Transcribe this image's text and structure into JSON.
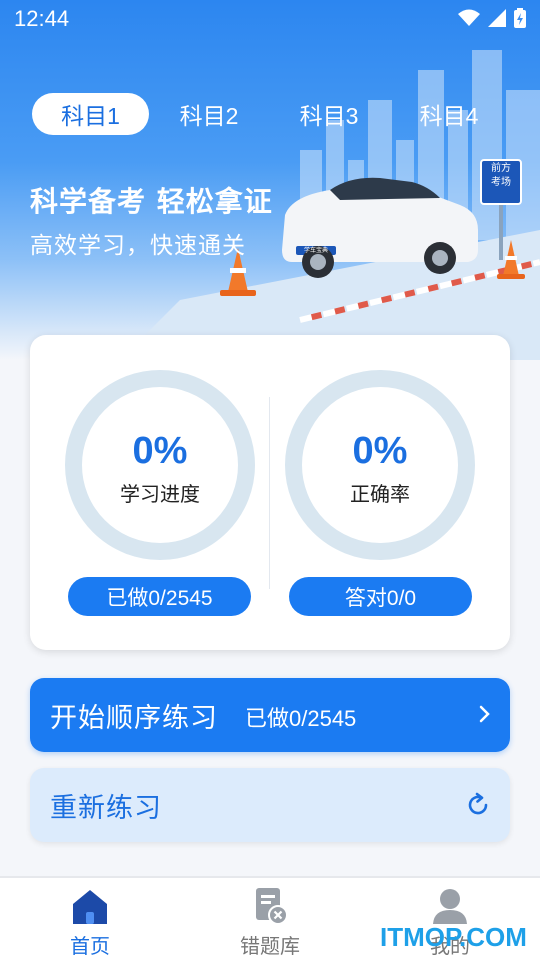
{
  "status_bar": {
    "time": "12:44"
  },
  "tabs": [
    {
      "label": "科目1",
      "active": true
    },
    {
      "label": "科目2",
      "active": false
    },
    {
      "label": "科目3",
      "active": false
    },
    {
      "label": "科目4",
      "active": false
    }
  ],
  "hero": {
    "headline": "科学备考 轻松拿证",
    "subline": "高效学习，快速通关",
    "sign_line1": "前方",
    "sign_line2": "考场",
    "car_plate": "学车宝典"
  },
  "stats": {
    "progress": {
      "value": "0%",
      "label": "学习进度",
      "pill": "已做0/2545",
      "fraction": 0
    },
    "accuracy": {
      "value": "0%",
      "label": "正确率",
      "pill": "答对0/0",
      "fraction": 0
    }
  },
  "actions": {
    "start_label": "开始顺序练习",
    "start_sub": "已做0/2545",
    "reset_label": "重新练习"
  },
  "bottom_nav": [
    {
      "label": "首页",
      "icon": "home-icon",
      "active": true
    },
    {
      "label": "错题库",
      "icon": "wrong-questions-icon",
      "active": false
    },
    {
      "label": "我的",
      "icon": "profile-icon",
      "active": false
    }
  ],
  "watermark": "ITMOP.COM",
  "colors": {
    "primary": "#1b7bf2",
    "primary_text": "#1b6fe0",
    "ring_track": "#d8e6f0",
    "reset_bg": "#dcebfc"
  }
}
